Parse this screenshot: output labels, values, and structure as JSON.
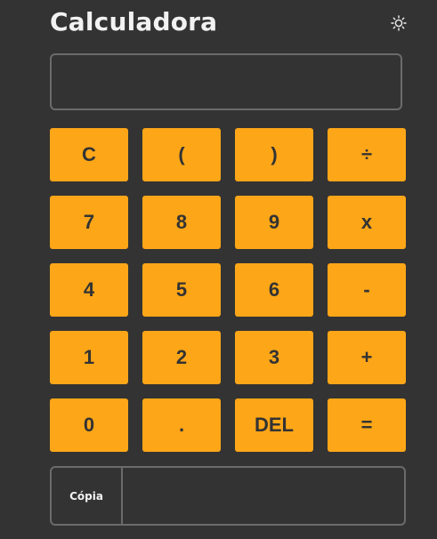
{
  "app": {
    "title": "Calculadora",
    "theme_icon": "sun-icon"
  },
  "display": {
    "value": "",
    "placeholder": ""
  },
  "keys": [
    {
      "label": "C",
      "name": "clear-button"
    },
    {
      "label": "(",
      "name": "open-paren-button"
    },
    {
      "label": ")",
      "name": "close-paren-button"
    },
    {
      "label": "÷",
      "name": "divide-button"
    },
    {
      "label": "7",
      "name": "digit-7-button"
    },
    {
      "label": "8",
      "name": "digit-8-button"
    },
    {
      "label": "9",
      "name": "digit-9-button"
    },
    {
      "label": "x",
      "name": "multiply-button"
    },
    {
      "label": "4",
      "name": "digit-4-button"
    },
    {
      "label": "5",
      "name": "digit-5-button"
    },
    {
      "label": "6",
      "name": "digit-6-button"
    },
    {
      "label": "-",
      "name": "subtract-button"
    },
    {
      "label": "1",
      "name": "digit-1-button"
    },
    {
      "label": "2",
      "name": "digit-2-button"
    },
    {
      "label": "3",
      "name": "digit-3-button"
    },
    {
      "label": "+",
      "name": "add-button"
    },
    {
      "label": "0",
      "name": "digit-0-button"
    },
    {
      "label": ".",
      "name": "decimal-button"
    },
    {
      "label": "DEL",
      "name": "delete-button"
    },
    {
      "label": "=",
      "name": "equals-button"
    }
  ],
  "copy": {
    "button_label": "Cópia",
    "output": ""
  },
  "colors": {
    "background": "#333333",
    "key": "#fca618",
    "key_text": "#333333",
    "border": "#6b6b6b",
    "text": "#f2f2f2"
  }
}
